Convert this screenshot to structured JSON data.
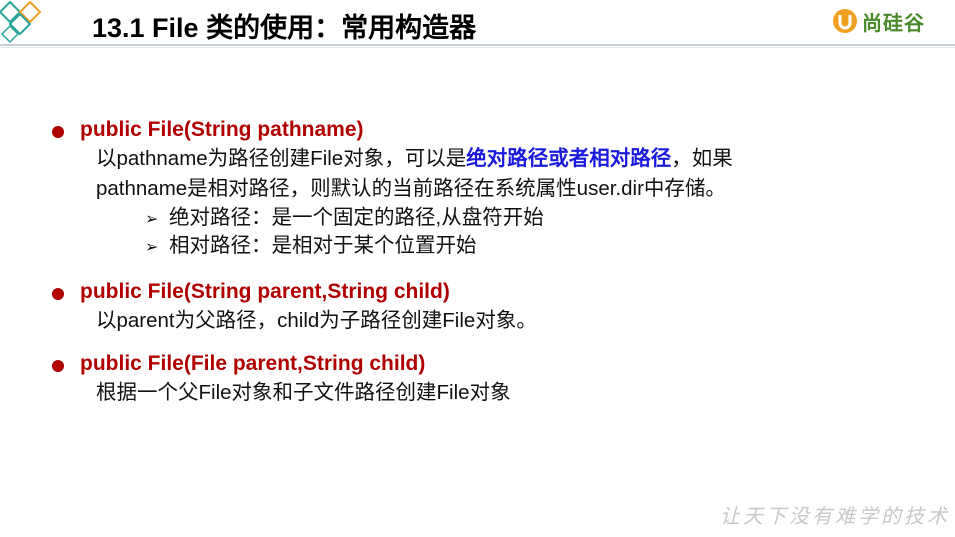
{
  "header": {
    "title": "13.1 File 类的使用：常用构造器",
    "logo_text": "尚硅谷"
  },
  "colors": {
    "accent_red": "#b00000",
    "highlight_blue": "#1a1adc",
    "logo_green": "#4a8a2a",
    "deco_teal": "#2aa39a",
    "deco_orange": "#f0a020"
  },
  "items": [
    {
      "title": "public File(String pathname)",
      "desc_line1_a": "以pathname为路径创建File对象，可以是",
      "desc_line1_hl": "绝对路径或者相对路径",
      "desc_line1_b": "，如果",
      "desc_line2": "pathname是相对路径，则默认的当前路径在系统属性user.dir中存储。",
      "subs": [
        "绝对路径：是一个固定的路径,从盘符开始",
        "相对路径：是相对于某个位置开始"
      ]
    },
    {
      "title": "public File(String parent,String child)",
      "desc_line1": "以parent为父路径，child为子路径创建File对象。"
    },
    {
      "title": "public File(File parent,String child)",
      "desc_line1": "根据一个父File对象和子文件路径创建File对象"
    }
  ],
  "arrow_glyph": "➢",
  "watermark": "让天下没有难学的技术"
}
